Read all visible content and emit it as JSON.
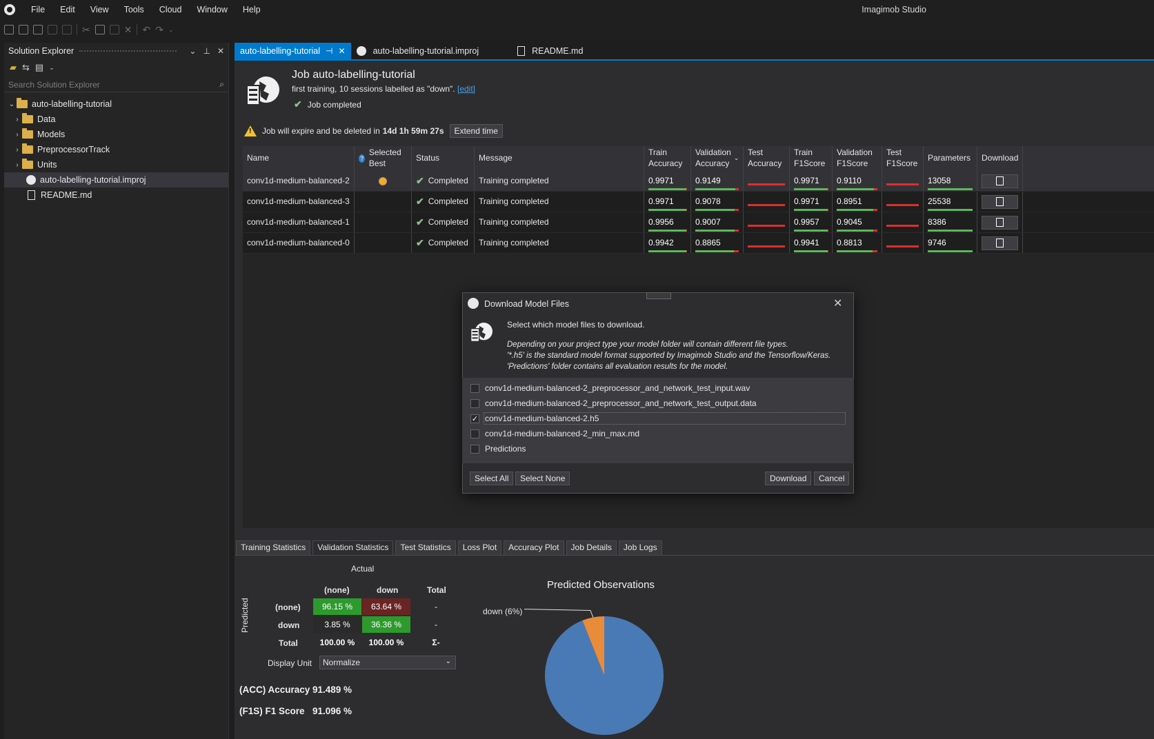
{
  "app": {
    "title": "Imagimob Studio"
  },
  "menu": [
    "File",
    "Edit",
    "View",
    "Tools",
    "Cloud",
    "Window",
    "Help"
  ],
  "solution_explorer": {
    "title": "Solution Explorer",
    "search_placeholder": "Search Solution Explorer",
    "tree": [
      {
        "label": "auto-labelling-tutorial",
        "type": "folder",
        "level": 0,
        "expanded": true
      },
      {
        "label": "Data",
        "type": "folder",
        "level": 1
      },
      {
        "label": "Models",
        "type": "folder",
        "level": 1
      },
      {
        "label": "PreprocessorTrack",
        "type": "folder",
        "level": 1
      },
      {
        "label": "Units",
        "type": "folder",
        "level": 1
      },
      {
        "label": "auto-labelling-tutorial.improj",
        "type": "project",
        "level": 1,
        "selected": true
      },
      {
        "label": "README.md",
        "type": "file",
        "level": 1
      }
    ]
  },
  "doc_tabs": [
    {
      "label": "auto-labelling-tutorial",
      "active": true
    },
    {
      "label": "auto-labelling-tutorial.improj",
      "active": false
    },
    {
      "label": "README.md",
      "active": false
    }
  ],
  "job": {
    "title": "Job auto-labelling-tutorial",
    "subtitle": "first training, 10 sessions labelled as \"down\".",
    "edit_link": "[edit]",
    "status": "Job completed",
    "expire_text": "Job will expire and be deleted in",
    "expire_time": "14d 1h 59m 27s",
    "extend_label": "Extend time"
  },
  "table": {
    "columns": [
      "Name",
      "Selected Best",
      "Status",
      "Message",
      "Train Accuracy",
      "Validation Accuracy",
      "Test Accuracy",
      "Train F1Score",
      "Validation F1Score",
      "Test F1Score",
      "Parameters",
      "Download"
    ],
    "rows": [
      {
        "name": "conv1d-medium-balanced-2",
        "best": true,
        "status": "Completed",
        "message": "Training completed",
        "train_acc": "0.9971",
        "val_acc": "0.9149",
        "test_acc": "",
        "train_f1": "0.9971",
        "val_f1": "0.9110",
        "test_f1": "",
        "params": "13058"
      },
      {
        "name": "conv1d-medium-balanced-3",
        "best": false,
        "status": "Completed",
        "message": "Training completed",
        "train_acc": "0.9971",
        "val_acc": "0.9078",
        "test_acc": "",
        "train_f1": "0.9971",
        "val_f1": "0.8951",
        "test_f1": "",
        "params": "25538"
      },
      {
        "name": "conv1d-medium-balanced-1",
        "best": false,
        "status": "Completed",
        "message": "Training completed",
        "train_acc": "0.9956",
        "val_acc": "0.9007",
        "test_acc": "",
        "train_f1": "0.9957",
        "val_f1": "0.9045",
        "test_f1": "",
        "params": "8386"
      },
      {
        "name": "conv1d-medium-balanced-0",
        "best": false,
        "status": "Completed",
        "message": "Training completed",
        "train_acc": "0.9942",
        "val_acc": "0.8865",
        "test_acc": "",
        "train_f1": "0.9941",
        "val_f1": "0.8813",
        "test_f1": "",
        "params": "9746"
      }
    ]
  },
  "dialog": {
    "title": "Download Model Files",
    "lead": "Select which model files to download.",
    "note": [
      "Depending on your project type your model folder will contain different file types.",
      "'*.h5' is the standard model format supported by Imagimob Studio and the Tensorflow/Keras.",
      "'Predictions' folder contains all evaluation results for the model."
    ],
    "options": [
      {
        "label": "conv1d-medium-balanced-2_preprocessor_and_network_test_input.wav",
        "checked": false
      },
      {
        "label": "conv1d-medium-balanced-2_preprocessor_and_network_test_output.data",
        "checked": false
      },
      {
        "label": "conv1d-medium-balanced-2.h5",
        "checked": true
      },
      {
        "label": "conv1d-medium-balanced-2_min_max.md",
        "checked": false
      },
      {
        "label": "Predictions",
        "checked": false
      }
    ],
    "select_all": "Select All",
    "select_none": "Select None",
    "download": "Download",
    "cancel": "Cancel"
  },
  "bottom_tabs": [
    "Training Statistics",
    "Validation Statistics",
    "Test Statistics",
    "Loss Plot",
    "Accuracy Plot",
    "Job Details",
    "Job Logs"
  ],
  "bottom_active_tab": "Validation Statistics",
  "confusion": {
    "actual_label": "Actual",
    "predicted_label": "Predicted",
    "col_headers": [
      "(none)",
      "down",
      "Total"
    ],
    "rows": [
      {
        "label": "(none)",
        "cells": [
          "96.15 %",
          "63.64 %",
          "-"
        ]
      },
      {
        "label": "down",
        "cells": [
          "3.85 %",
          "36.36 %",
          "-"
        ]
      },
      {
        "label": "Total",
        "cells": [
          "100.00 %",
          "100.00 %",
          "Σ-"
        ]
      }
    ],
    "display_unit_label": "Display Unit",
    "display_unit_value": "Normalize",
    "accuracy_label": "(ACC) Accuracy",
    "accuracy_value": "91.489 %",
    "f1_label": "(F1S) F1 Score",
    "f1_value": "91.096 %",
    "colors": {
      "good": "#2d9a2d",
      "bad": "#6b2424",
      "neutral": "#2a2a2a"
    }
  },
  "chart_data": {
    "type": "pie",
    "title": "Predicted Observations",
    "slices": [
      {
        "label": "down (6%)",
        "value": 6,
        "color": "#e88c3a"
      },
      {
        "label": "",
        "value": 94,
        "color": "#4a7ab5"
      }
    ]
  }
}
